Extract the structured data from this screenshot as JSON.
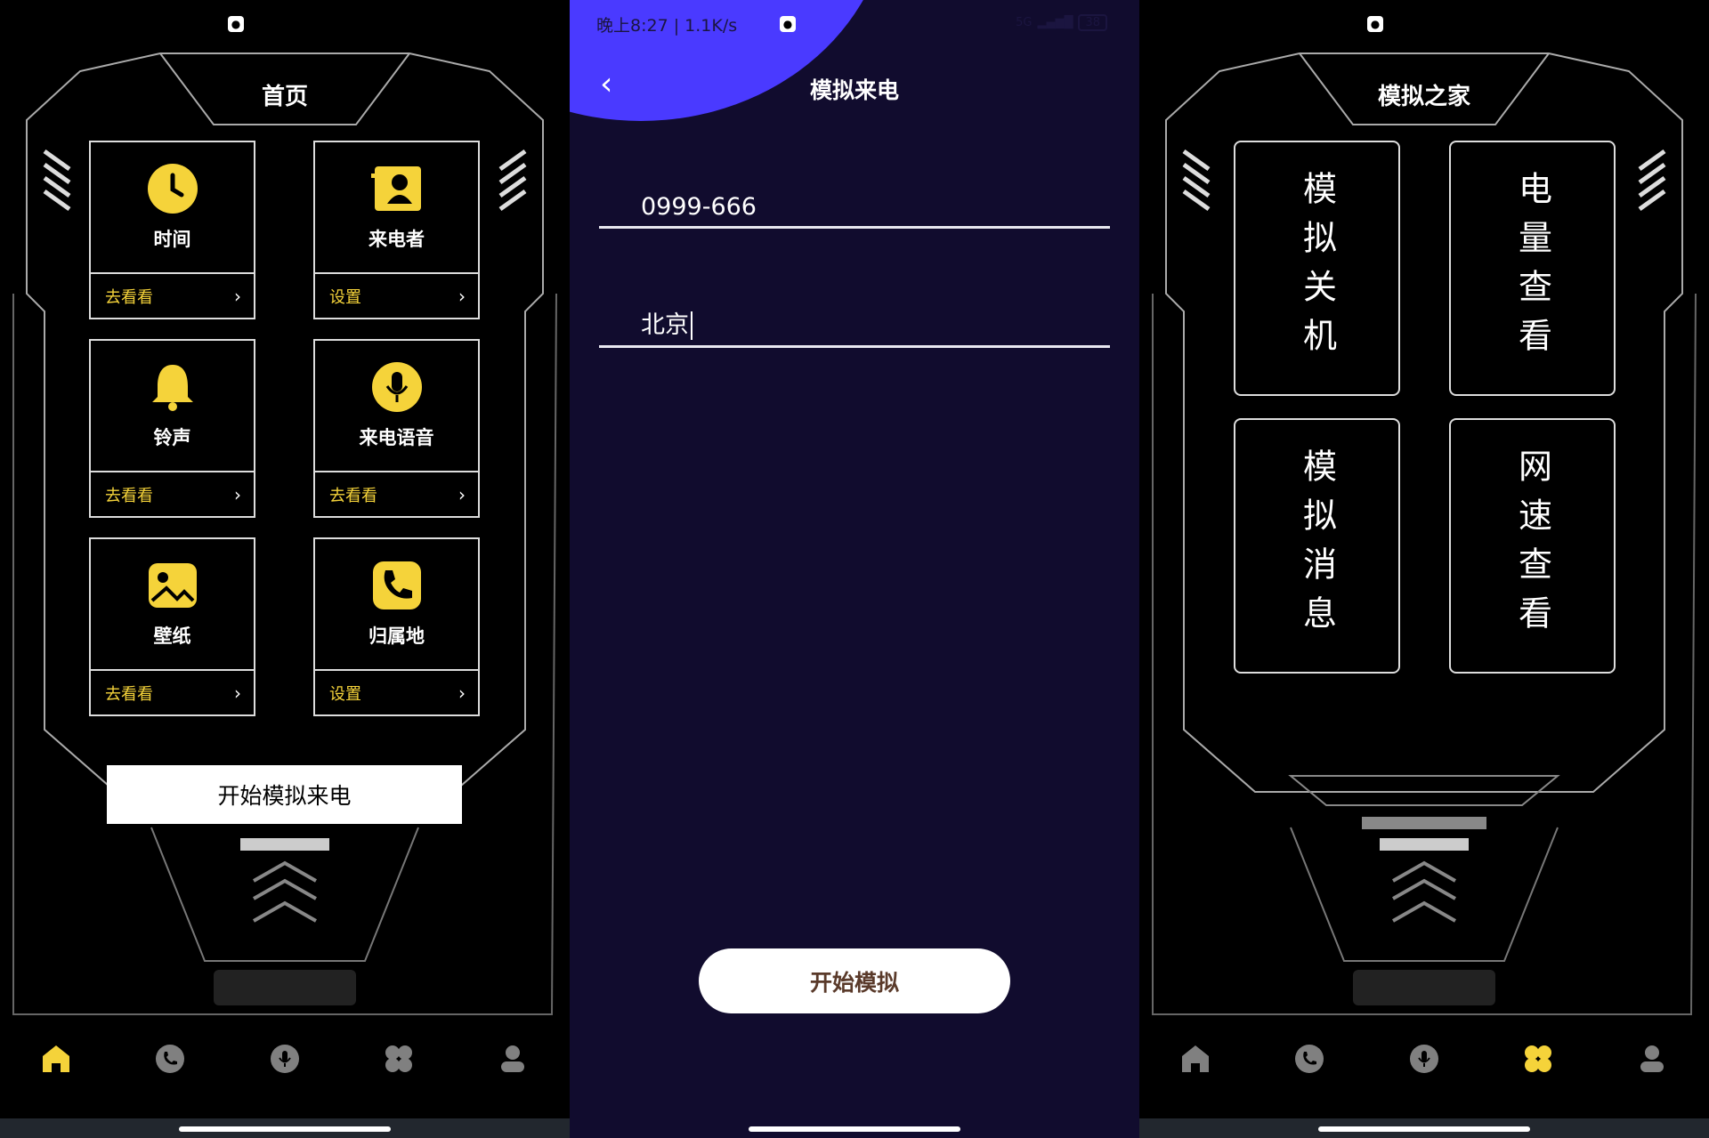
{
  "colors": {
    "accent_yellow": "#f5d33a",
    "bg_middle": "#110c2e",
    "blob_purple": "#4a3aff",
    "button_text": "#5a3a2a",
    "nav_inactive": "#808080"
  },
  "home": {
    "title": "首页",
    "cards": [
      {
        "icon": "clock-icon",
        "label": "时间",
        "link": "去看看"
      },
      {
        "icon": "contact-card-icon",
        "label": "来电者",
        "link": "设置"
      },
      {
        "icon": "bell-icon",
        "label": "铃声",
        "link": "去看看"
      },
      {
        "icon": "microphone-icon",
        "label": "来电语音",
        "link": "去看看"
      },
      {
        "icon": "image-icon",
        "label": "壁纸",
        "link": "去看看"
      },
      {
        "icon": "phone-icon",
        "label": "归属地",
        "link": "设置"
      }
    ],
    "start_button": "开始模拟来电",
    "nav_active": 0
  },
  "nav": [
    {
      "icon": "home-icon"
    },
    {
      "icon": "phone-icon"
    },
    {
      "icon": "microphone-icon"
    },
    {
      "icon": "grid-icon"
    },
    {
      "icon": "user-icon"
    }
  ],
  "sim": {
    "status_time": "晚上8:27 | 1.1K/s",
    "battery": "38",
    "network": "5G",
    "title": "模拟来电",
    "number_value": "0999-666",
    "location_value": "北京",
    "start_button": "开始模拟"
  },
  "house": {
    "title": "模拟之家",
    "cards": [
      {
        "label": "模拟关机",
        "chars": [
          "模",
          "拟",
          "关",
          "机"
        ]
      },
      {
        "label": "电量查看",
        "chars": [
          "电",
          "量",
          "查",
          "看"
        ]
      },
      {
        "label": "模拟消息",
        "chars": [
          "模",
          "拟",
          "消",
          "息"
        ]
      },
      {
        "label": "网速查看",
        "chars": [
          "网",
          "速",
          "查",
          "看"
        ]
      }
    ],
    "nav_active": 3
  }
}
